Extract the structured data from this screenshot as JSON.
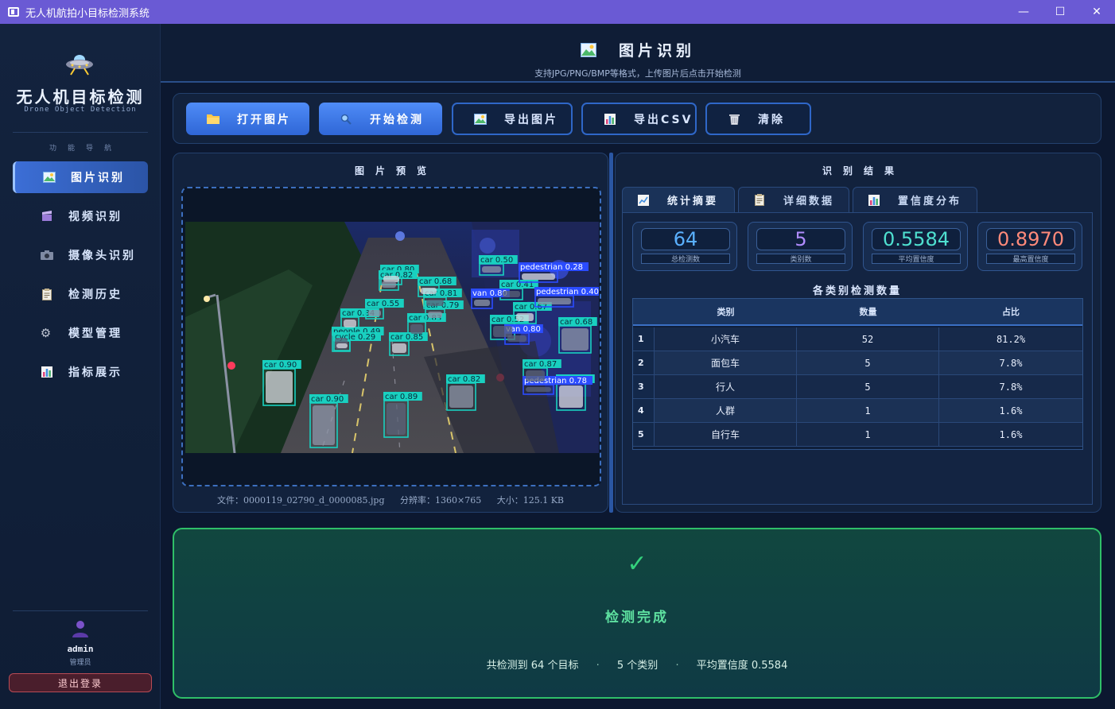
{
  "window": {
    "title": "无人机航拍小目标检测系统",
    "controls": [
      "—",
      "☐",
      "✕"
    ]
  },
  "sidebar": {
    "brand_title": "无人机目标检测",
    "brand_subtitle": "Drone Object Detection",
    "nav_caption": "功能导航",
    "items": [
      {
        "label": "图片识别",
        "icon": "image-icon",
        "active": true
      },
      {
        "label": "视频识别",
        "icon": "clapperboard-icon",
        "active": false
      },
      {
        "label": "摄像头识别",
        "icon": "camera-icon",
        "active": false
      },
      {
        "label": "检测历史",
        "icon": "clipboard-icon",
        "active": false
      },
      {
        "label": "模型管理",
        "icon": "gear-icon",
        "active": false
      },
      {
        "label": "指标展示",
        "icon": "bar-chart-icon",
        "active": false
      }
    ],
    "user": {
      "name": "admin",
      "role": "管理员"
    },
    "logout_label": "退出登录"
  },
  "header": {
    "title": "图片识别",
    "subtitle": "支持JPG/PNG/BMP等格式，上传图片后点击开始检测"
  },
  "toolbar": {
    "open_label": "打开图片",
    "detect_label": "开始检测",
    "export_image_label": "导出图片",
    "export_csv_label": "导出CSV",
    "clear_label": "清除"
  },
  "preview": {
    "title": "图片预览",
    "file_name": "文件：0000119_02790_d_0000085.jpg",
    "resolution": "分辨率：1360×765",
    "size": "大小：125.1 KB",
    "detection_labels": [
      "car 0.90",
      "car 0.90",
      "car 0.89",
      "car 0.84",
      "car 0.55",
      "car 0.83",
      "car 0.85",
      "car 0.79",
      "car 0.81",
      "car 0.68",
      "car 0.50",
      "car 0.41",
      "car 0.67",
      "car 0.82",
      "car 0.87",
      "car 0.86",
      "car 0.68",
      "car 0.52",
      "car 0.80",
      "car 0.82",
      "people 0.49",
      "cycle 0.29",
      "van 0.80",
      "van 0.80",
      "pedestrian 0.28",
      "pedestrian 0.40",
      "pedestrian 0.78"
    ]
  },
  "results": {
    "title": "识别结果",
    "tabs": [
      {
        "label": "统计摘要",
        "icon": "line-chart-icon",
        "active": true
      },
      {
        "label": "详细数据",
        "icon": "clipboard-icon",
        "active": false
      },
      {
        "label": "置信度分布",
        "icon": "bar-chart-icon",
        "active": false
      }
    ],
    "stats": [
      {
        "value": "64",
        "label": "总检测数",
        "color": "#5ab0ff"
      },
      {
        "value": "5",
        "label": "类别数",
        "color": "#b08cff"
      },
      {
        "value": "0.5584",
        "label": "平均置信度",
        "color": "#4fe0d0"
      },
      {
        "value": "0.8970",
        "label": "最高置信度",
        "color": "#ff8a7a"
      }
    ],
    "class_heading": "各类别检测数量",
    "table": {
      "headers": [
        "类别",
        "数量",
        "占比"
      ],
      "rows": [
        {
          "idx": "1",
          "name": "小汽车",
          "count": "52",
          "ratio": "81.2%"
        },
        {
          "idx": "2",
          "name": "面包车",
          "count": "5",
          "ratio": "7.8%"
        },
        {
          "idx": "3",
          "name": "行人",
          "count": "5",
          "ratio": "7.8%"
        },
        {
          "idx": "4",
          "name": "人群",
          "count": "1",
          "ratio": "1.6%"
        },
        {
          "idx": "5",
          "name": "自行车",
          "count": "1",
          "ratio": "1.6%"
        }
      ]
    }
  },
  "completion": {
    "icon": "✓",
    "title": "检测完成",
    "summary_total": "共检测到 64 个目标",
    "summary_classes": "5 个类别",
    "summary_avg": "平均置信度 0.5584",
    "separator": "·"
  },
  "colors": {
    "accent": "#3c6ed6",
    "success": "#34d17c",
    "box": "#19d0c0"
  }
}
